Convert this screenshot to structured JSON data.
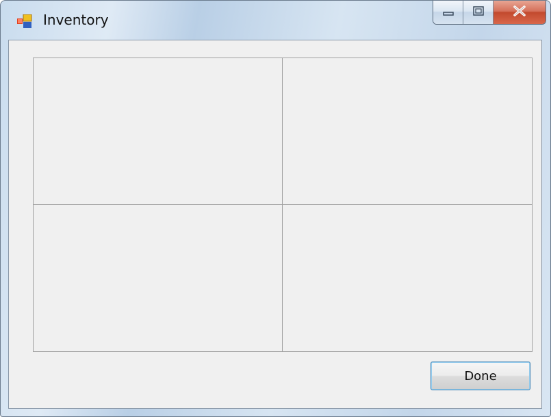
{
  "window": {
    "title": "Inventory"
  },
  "caption": {
    "minimize_icon": "minimize-icon",
    "maximize_icon": "maximize-icon",
    "close_icon": "close-icon"
  },
  "grid": {
    "rows": 2,
    "columns": 2
  },
  "buttons": {
    "done_label": "Done"
  },
  "colors": {
    "client_background": "#f0f0f0",
    "grid_lines": "#a0a0a0",
    "close_button": "#c24a2e",
    "focus_border": "#3c7fb1"
  }
}
